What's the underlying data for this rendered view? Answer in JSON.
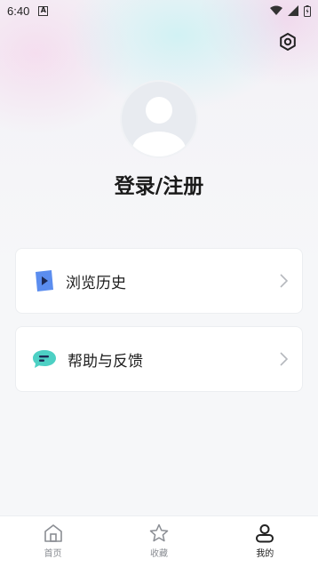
{
  "status_bar": {
    "time": "6:40"
  },
  "profile": {
    "login_label": "登录/注册"
  },
  "menu": [
    {
      "label": "浏览历史",
      "icon": "play-history-icon",
      "color": "#5b8def"
    },
    {
      "label": "帮助与反馈",
      "icon": "chat-feedback-icon",
      "color": "#4dd0c4"
    }
  ],
  "tabs": [
    {
      "label": "首页",
      "icon": "home-icon",
      "active": false
    },
    {
      "label": "收藏",
      "icon": "star-icon",
      "active": false
    },
    {
      "label": "我的",
      "icon": "person-icon",
      "active": true
    }
  ]
}
